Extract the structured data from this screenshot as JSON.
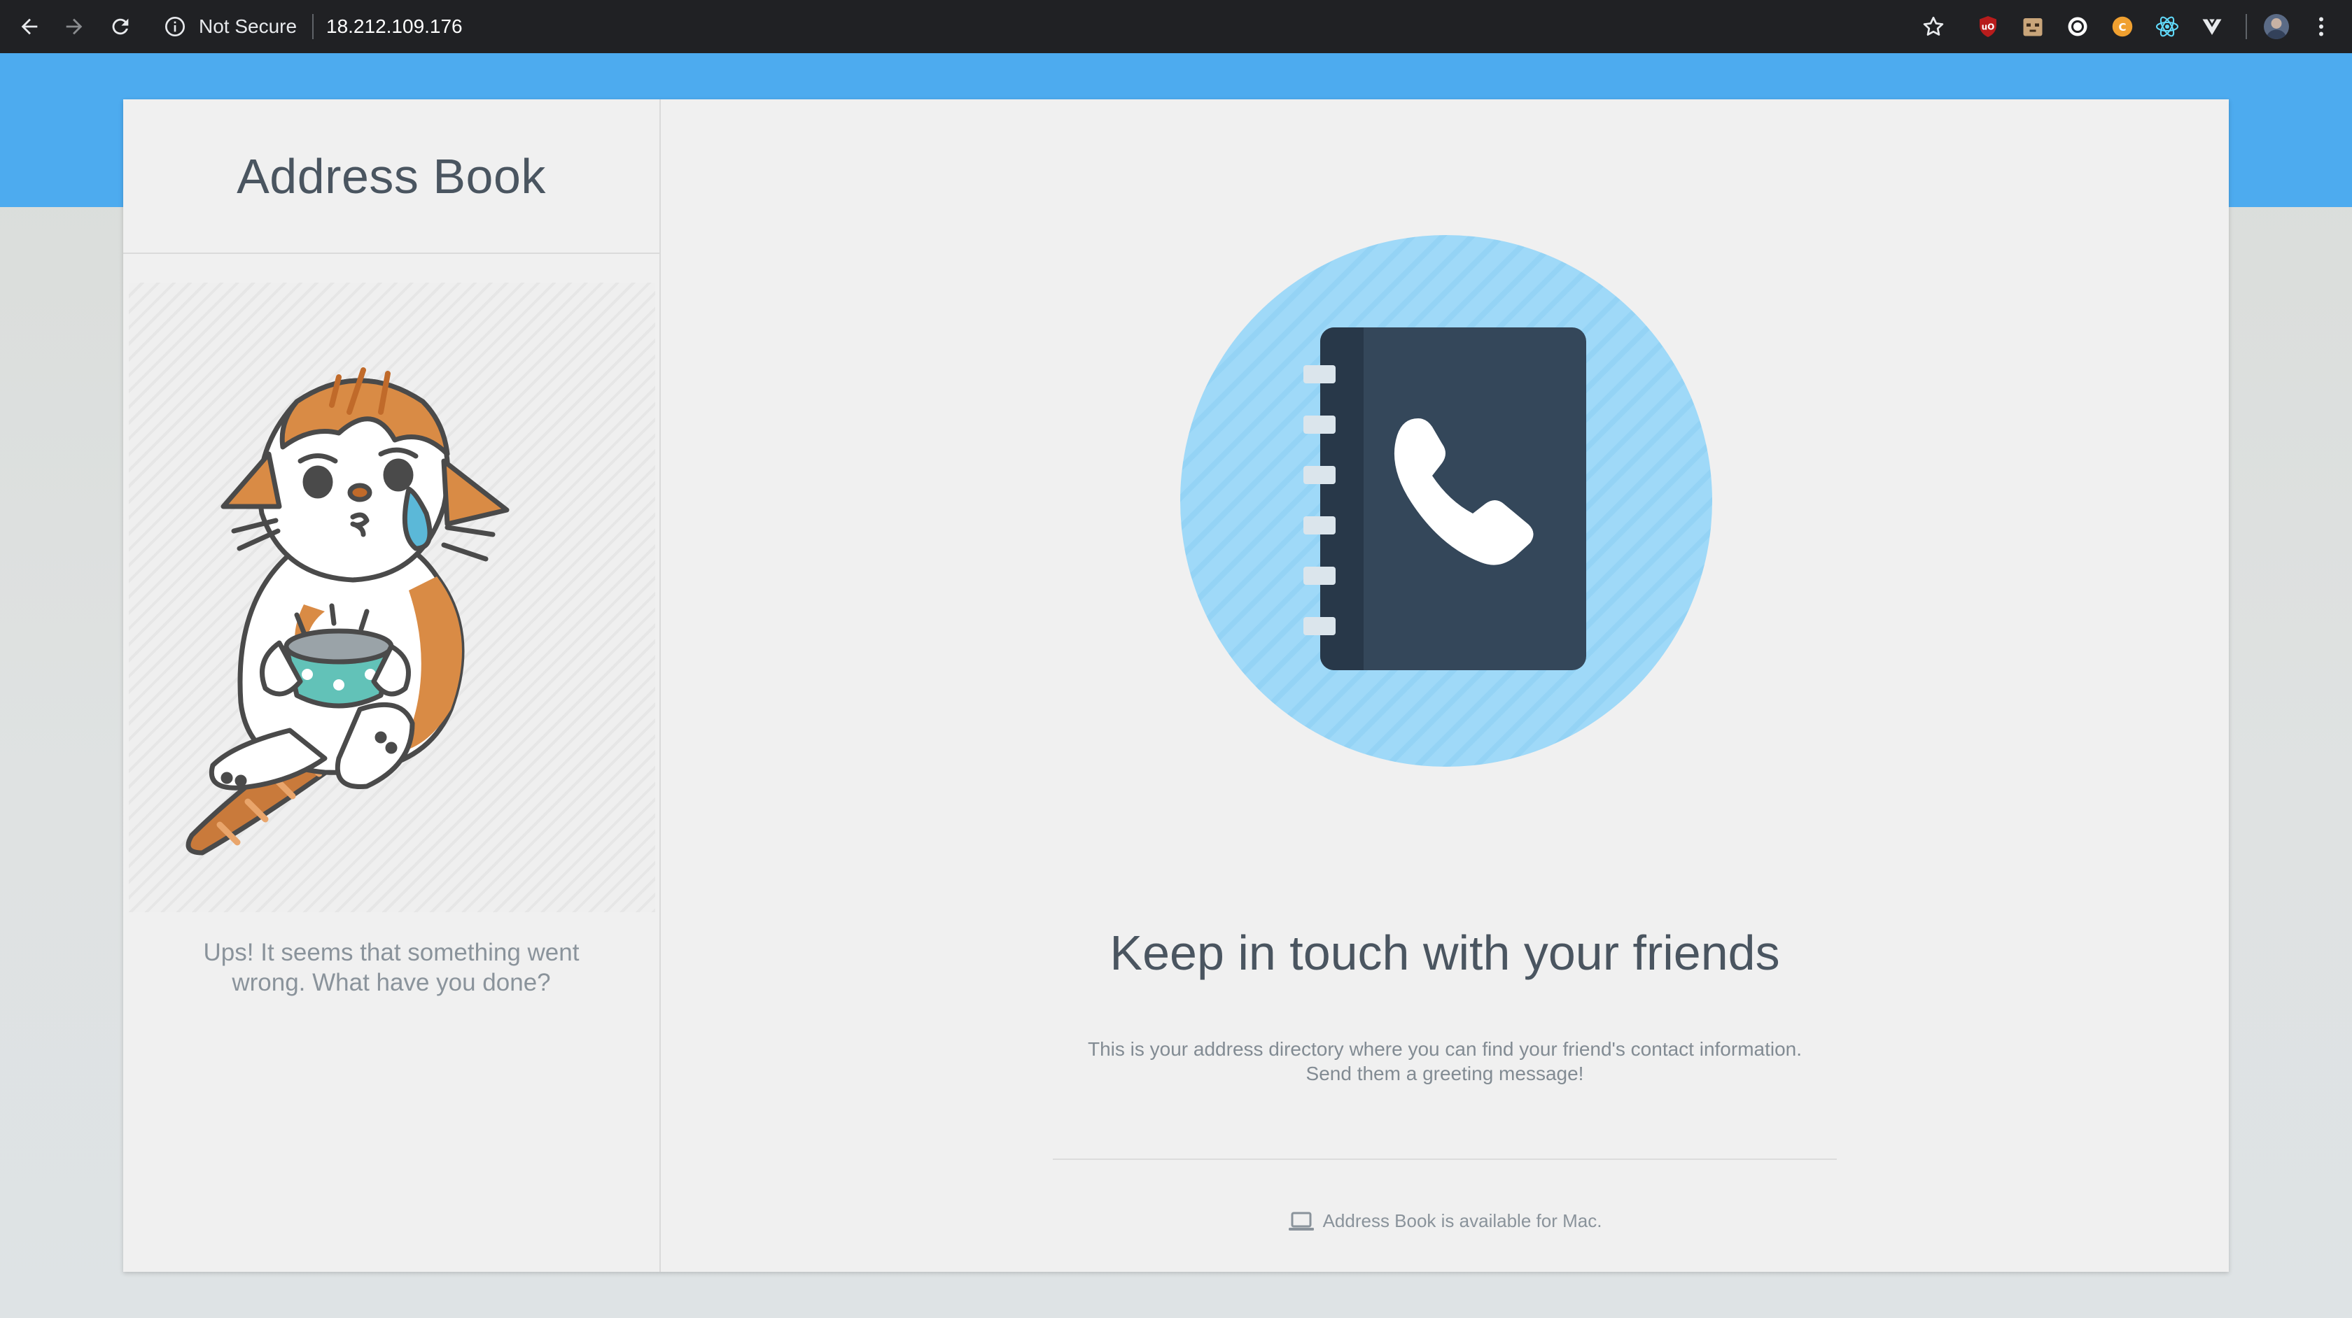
{
  "browser": {
    "security_label": "Not Secure",
    "url": "18.212.109.176",
    "icons": [
      "back-arrow-icon",
      "forward-arrow-icon",
      "reload-icon",
      "info-icon",
      "star-icon",
      "kebab-menu-icon"
    ],
    "extensions": [
      "ublock-icon",
      "extension-box-icon",
      "circle-extension-icon",
      "coin-extension-icon",
      "react-devtools-icon",
      "vue-devtools-icon",
      "profile-avatar-icon"
    ]
  },
  "sidebar": {
    "title": "Address Book",
    "illustration": "crying-cat-illustration",
    "error_message": "Ups! It seems that something went wrong. What have you done?"
  },
  "main": {
    "illustration": "address-book-phone-icon",
    "headline": "Keep in touch with your friends",
    "description_line1": "This is your address directory where you can find your friend's contact information.",
    "description_line2": "Send them a greeting message!",
    "availability_icon": "laptop-icon",
    "availability": "Address Book is available for Mac."
  },
  "colors": {
    "header_band": "#4dabef",
    "card_bg": "#f0f0f0",
    "hero_circle": "#9fd9f8",
    "book_cover": "#34475a",
    "text_dark": "#4a5560",
    "text_muted": "#8a939b"
  }
}
